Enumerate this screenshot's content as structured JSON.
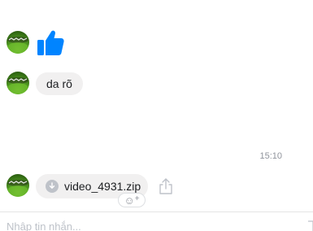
{
  "conversation": {
    "messages": [
      {
        "type": "like",
        "icon": "thumbs-up-icon",
        "color": "#0084ff"
      },
      {
        "type": "text",
        "text": "da rõ"
      },
      {
        "type": "file",
        "file_name": "video_4931.zip",
        "icon": "download-icon"
      }
    ],
    "timestamp": "15:10",
    "actions": {
      "share_icon": "share-icon",
      "reaction_icon": "smiley-plus-icon",
      "reaction_glyph": "☺",
      "reaction_plus": "+"
    }
  },
  "composer": {
    "placeholder": "Nhập tin nhắn..."
  },
  "colors": {
    "accent": "#0084ff",
    "bubble": "#f1f0f0",
    "timestamp": "#90949c"
  }
}
